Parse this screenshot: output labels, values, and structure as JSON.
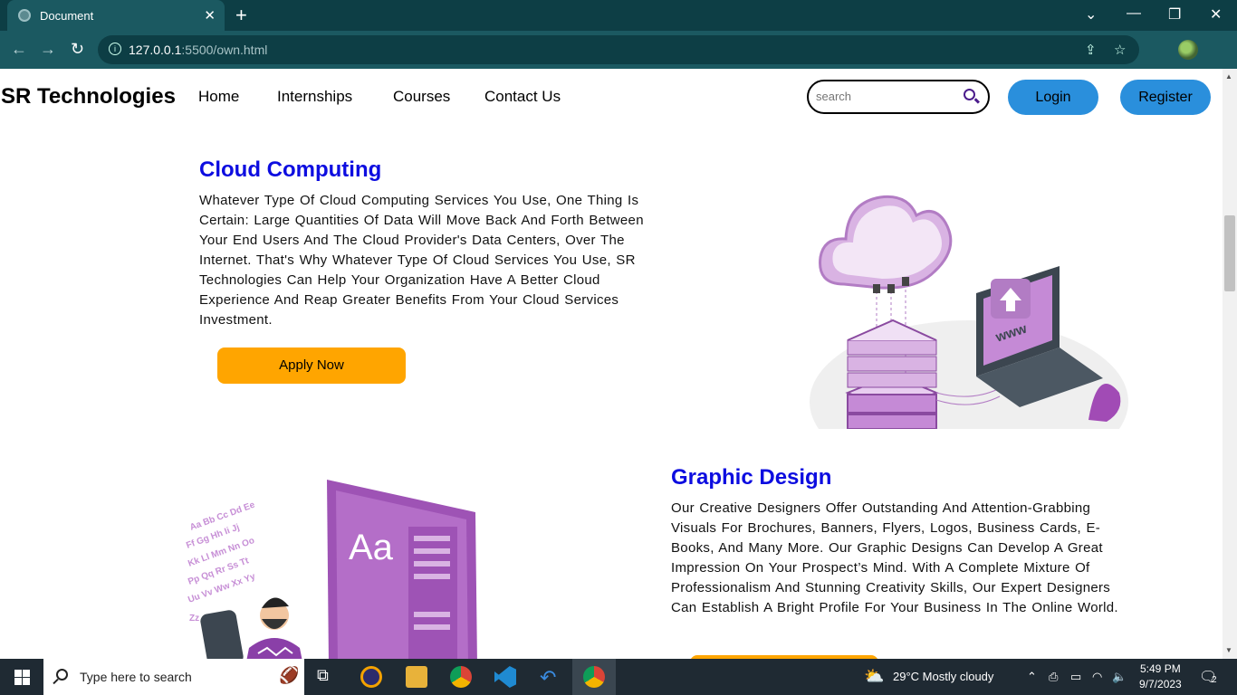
{
  "browser": {
    "tab_title": "Document",
    "tab_close": "✕",
    "new_tab": "+",
    "url_host": "127.0.0.1",
    "url_rest": ":5500/own.html"
  },
  "header": {
    "brand": "SR Technologies",
    "nav": [
      "Home",
      "Internships",
      "Courses",
      "Contact Us"
    ],
    "search_placeholder": "search",
    "login": "Login",
    "register": "Register"
  },
  "sections": [
    {
      "title": "Cloud Computing",
      "text": "Whatever Type Of Cloud Computing Services You Use, One Thing Is Certain: Large Quantities Of Data Will Move Back And Forth Between Your End Users And The Cloud Provider's Data Centers, Over The Internet. That's Why Whatever Type Of Cloud Services You Use, SR Technologies Can Help Your Organization Have A Better Cloud Experience And Reap Greater Benefits From Your Cloud Services Investment.",
      "button": "Apply Now",
      "illustration_text": "www"
    },
    {
      "title": "Graphic Design",
      "text": "Our Creative Designers Offer Outstanding And Attention-Grabbing Visuals For Brochures, Banners, Flyers, Logos, Business Cards, E-Books, And Many More. Our Graphic Designs Can Develop A Great Impression On Your Prospect’s Mind. With A Complete Mixture Of Professionalism And Stunning Creativity Skills, Our Expert Designers Can Establish A Bright Profile For Your Business In The Online World.",
      "illustration_text": "Aa"
    }
  ],
  "taskbar": {
    "search_label": "Type here to search",
    "weather": "29°C  Mostly cloudy",
    "time": "5:49 PM",
    "date": "9/7/2023",
    "notifications": "2"
  },
  "colors": {
    "heading": "#0d0de0",
    "button_blue": "#2a8fdc",
    "apply_orange": "#ffa500",
    "chrome_dark": "#0d3e45",
    "chrome_mid": "#1b5961"
  }
}
